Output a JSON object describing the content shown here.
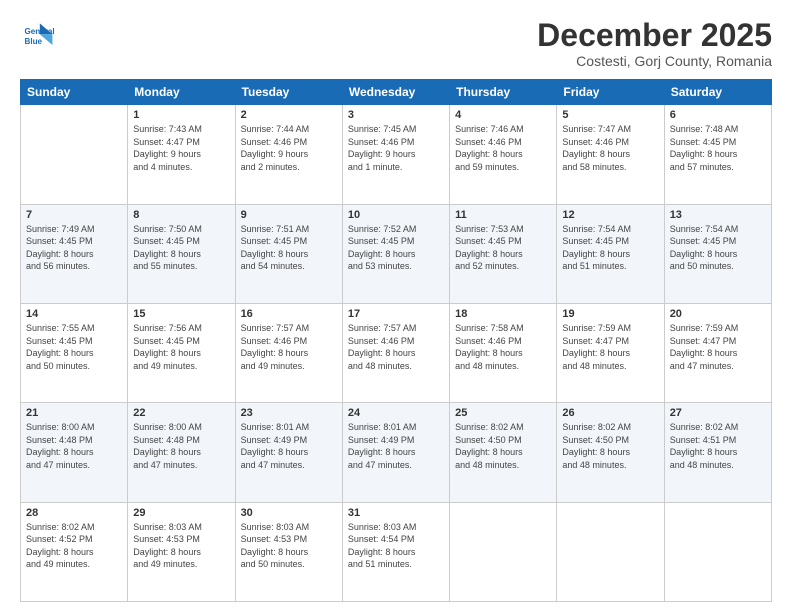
{
  "logo": {
    "line1": "General",
    "line2": "Blue"
  },
  "header": {
    "month": "December 2025",
    "location": "Costesti, Gorj County, Romania"
  },
  "weekdays": [
    "Sunday",
    "Monday",
    "Tuesday",
    "Wednesday",
    "Thursday",
    "Friday",
    "Saturday"
  ],
  "weeks": [
    [
      {
        "day": "",
        "info": ""
      },
      {
        "day": "1",
        "info": "Sunrise: 7:43 AM\nSunset: 4:47 PM\nDaylight: 9 hours\nand 4 minutes."
      },
      {
        "day": "2",
        "info": "Sunrise: 7:44 AM\nSunset: 4:46 PM\nDaylight: 9 hours\nand 2 minutes."
      },
      {
        "day": "3",
        "info": "Sunrise: 7:45 AM\nSunset: 4:46 PM\nDaylight: 9 hours\nand 1 minute."
      },
      {
        "day": "4",
        "info": "Sunrise: 7:46 AM\nSunset: 4:46 PM\nDaylight: 8 hours\nand 59 minutes."
      },
      {
        "day": "5",
        "info": "Sunrise: 7:47 AM\nSunset: 4:46 PM\nDaylight: 8 hours\nand 58 minutes."
      },
      {
        "day": "6",
        "info": "Sunrise: 7:48 AM\nSunset: 4:45 PM\nDaylight: 8 hours\nand 57 minutes."
      }
    ],
    [
      {
        "day": "7",
        "info": "Sunrise: 7:49 AM\nSunset: 4:45 PM\nDaylight: 8 hours\nand 56 minutes."
      },
      {
        "day": "8",
        "info": "Sunrise: 7:50 AM\nSunset: 4:45 PM\nDaylight: 8 hours\nand 55 minutes."
      },
      {
        "day": "9",
        "info": "Sunrise: 7:51 AM\nSunset: 4:45 PM\nDaylight: 8 hours\nand 54 minutes."
      },
      {
        "day": "10",
        "info": "Sunrise: 7:52 AM\nSunset: 4:45 PM\nDaylight: 8 hours\nand 53 minutes."
      },
      {
        "day": "11",
        "info": "Sunrise: 7:53 AM\nSunset: 4:45 PM\nDaylight: 8 hours\nand 52 minutes."
      },
      {
        "day": "12",
        "info": "Sunrise: 7:54 AM\nSunset: 4:45 PM\nDaylight: 8 hours\nand 51 minutes."
      },
      {
        "day": "13",
        "info": "Sunrise: 7:54 AM\nSunset: 4:45 PM\nDaylight: 8 hours\nand 50 minutes."
      }
    ],
    [
      {
        "day": "14",
        "info": "Sunrise: 7:55 AM\nSunset: 4:45 PM\nDaylight: 8 hours\nand 50 minutes."
      },
      {
        "day": "15",
        "info": "Sunrise: 7:56 AM\nSunset: 4:45 PM\nDaylight: 8 hours\nand 49 minutes."
      },
      {
        "day": "16",
        "info": "Sunrise: 7:57 AM\nSunset: 4:46 PM\nDaylight: 8 hours\nand 49 minutes."
      },
      {
        "day": "17",
        "info": "Sunrise: 7:57 AM\nSunset: 4:46 PM\nDaylight: 8 hours\nand 48 minutes."
      },
      {
        "day": "18",
        "info": "Sunrise: 7:58 AM\nSunset: 4:46 PM\nDaylight: 8 hours\nand 48 minutes."
      },
      {
        "day": "19",
        "info": "Sunrise: 7:59 AM\nSunset: 4:47 PM\nDaylight: 8 hours\nand 48 minutes."
      },
      {
        "day": "20",
        "info": "Sunrise: 7:59 AM\nSunset: 4:47 PM\nDaylight: 8 hours\nand 47 minutes."
      }
    ],
    [
      {
        "day": "21",
        "info": "Sunrise: 8:00 AM\nSunset: 4:48 PM\nDaylight: 8 hours\nand 47 minutes."
      },
      {
        "day": "22",
        "info": "Sunrise: 8:00 AM\nSunset: 4:48 PM\nDaylight: 8 hours\nand 47 minutes."
      },
      {
        "day": "23",
        "info": "Sunrise: 8:01 AM\nSunset: 4:49 PM\nDaylight: 8 hours\nand 47 minutes."
      },
      {
        "day": "24",
        "info": "Sunrise: 8:01 AM\nSunset: 4:49 PM\nDaylight: 8 hours\nand 47 minutes."
      },
      {
        "day": "25",
        "info": "Sunrise: 8:02 AM\nSunset: 4:50 PM\nDaylight: 8 hours\nand 48 minutes."
      },
      {
        "day": "26",
        "info": "Sunrise: 8:02 AM\nSunset: 4:50 PM\nDaylight: 8 hours\nand 48 minutes."
      },
      {
        "day": "27",
        "info": "Sunrise: 8:02 AM\nSunset: 4:51 PM\nDaylight: 8 hours\nand 48 minutes."
      }
    ],
    [
      {
        "day": "28",
        "info": "Sunrise: 8:02 AM\nSunset: 4:52 PM\nDaylight: 8 hours\nand 49 minutes."
      },
      {
        "day": "29",
        "info": "Sunrise: 8:03 AM\nSunset: 4:53 PM\nDaylight: 8 hours\nand 49 minutes."
      },
      {
        "day": "30",
        "info": "Sunrise: 8:03 AM\nSunset: 4:53 PM\nDaylight: 8 hours\nand 50 minutes."
      },
      {
        "day": "31",
        "info": "Sunrise: 8:03 AM\nSunset: 4:54 PM\nDaylight: 8 hours\nand 51 minutes."
      },
      {
        "day": "",
        "info": ""
      },
      {
        "day": "",
        "info": ""
      },
      {
        "day": "",
        "info": ""
      }
    ]
  ]
}
